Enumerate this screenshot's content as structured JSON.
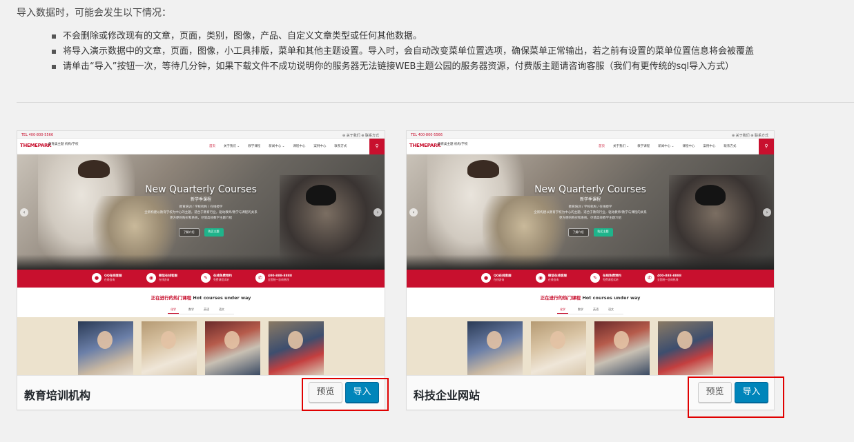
{
  "intro": "导入数据时，可能会发生以下情况：",
  "bullets": [
    "不会删除或修改现有的文章，页面，类别，图像，产品、自定义文章类型或任何其他数据。",
    "将导入演示数据中的文章，页面，图像，小工具排版，菜单和其他主题设置。导入时，会自动改变菜单位置选项，确保菜单正常输出，若之前有设置的菜单位置信息将会被覆盖",
    "请单击“导入”按钮一次，等待几分钟，如果下载文件不成功说明你的服务器无法链接WEB主题公园的服务器资源，付费版主题请咨询客服（我们有更传统的sql导入方式）"
  ],
  "preview": {
    "tel": "TEL 400-800-5566",
    "top_right": "⊕ 关于我们   ⊕ 联系方式",
    "logo": "THEMEPARK",
    "logo_sub": "教育类主题 机构/学校",
    "nav": [
      "首页",
      "关于我们 ⌄",
      "教学课程",
      "新闻中心 ⌄",
      "课程中心",
      "案例中心",
      "联系方式"
    ],
    "hero_title": "New Quarterly Courses",
    "hero_sub": "新学季课程",
    "hero_lines": [
      "教育培训 / 学校机构 / 在线授学",
      "全新构建以教育学校为中心的主题，适合于教育行业，驱动教师/教学与课程的关系",
      "更方便的购买和系统，尽情高效教学主题介绍"
    ],
    "hero_btn1": "了解介绍",
    "hero_btn2": "购买主题",
    "features": [
      {
        "title": "QQ在线客服",
        "sub": "在线咨询"
      },
      {
        "title": "微信在线客服",
        "sub": "在线咨询"
      },
      {
        "title": "在线免费预约",
        "sub": "免费课程试听"
      },
      {
        "title": "400-888-8888",
        "sub": "全国统一咨询热线"
      }
    ],
    "section_title_cn": "正在进行的热门课程",
    "section_title_en": "Hot courses under way",
    "tabs": [
      "化学",
      "数学",
      "英语",
      "语文"
    ]
  },
  "cards": [
    {
      "name": "教育培训机构",
      "preview_label": "预览",
      "import_label": "导入"
    },
    {
      "name": "科技企业网站",
      "preview_label": "预览",
      "import_label": "导入"
    }
  ],
  "colors": {
    "brand_red": "#c8102e",
    "import_blue": "#0085ba",
    "highlight": "#e00000"
  }
}
